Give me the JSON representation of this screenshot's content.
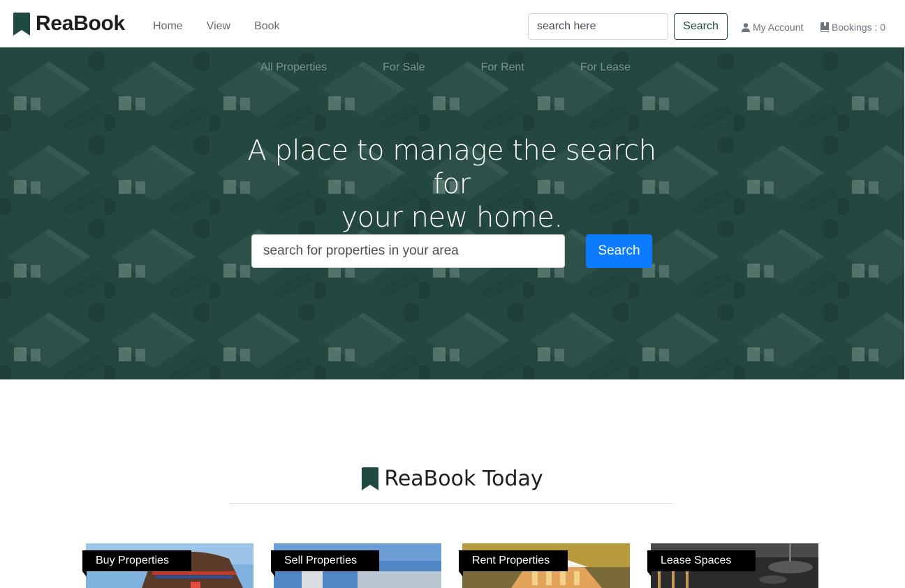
{
  "brand": {
    "name": "ReaBook"
  },
  "nav": {
    "links": [
      "Home",
      "View",
      "Book"
    ]
  },
  "top_search": {
    "placeholder": "search here",
    "button_label": "Search"
  },
  "account": {
    "label": "My Account"
  },
  "bookings": {
    "label": "Bookings : 0"
  },
  "hero": {
    "filters": [
      "All Properties",
      "For Sale",
      "For Rent",
      "For Lease"
    ],
    "headline_line1": "A place to manage the search for",
    "headline_line2": "your new home.",
    "search_placeholder": "search for properties in your area",
    "search_button": "Search"
  },
  "section": {
    "title": "ReaBook Today"
  },
  "cards": [
    {
      "label": "Buy Properties"
    },
    {
      "label": "Sell Properties"
    },
    {
      "label": "Rent Properties"
    },
    {
      "label": "Lease Spaces"
    }
  ],
  "colors": {
    "brand_green": "#1f4a42",
    "primary_blue": "#0d7bff"
  }
}
